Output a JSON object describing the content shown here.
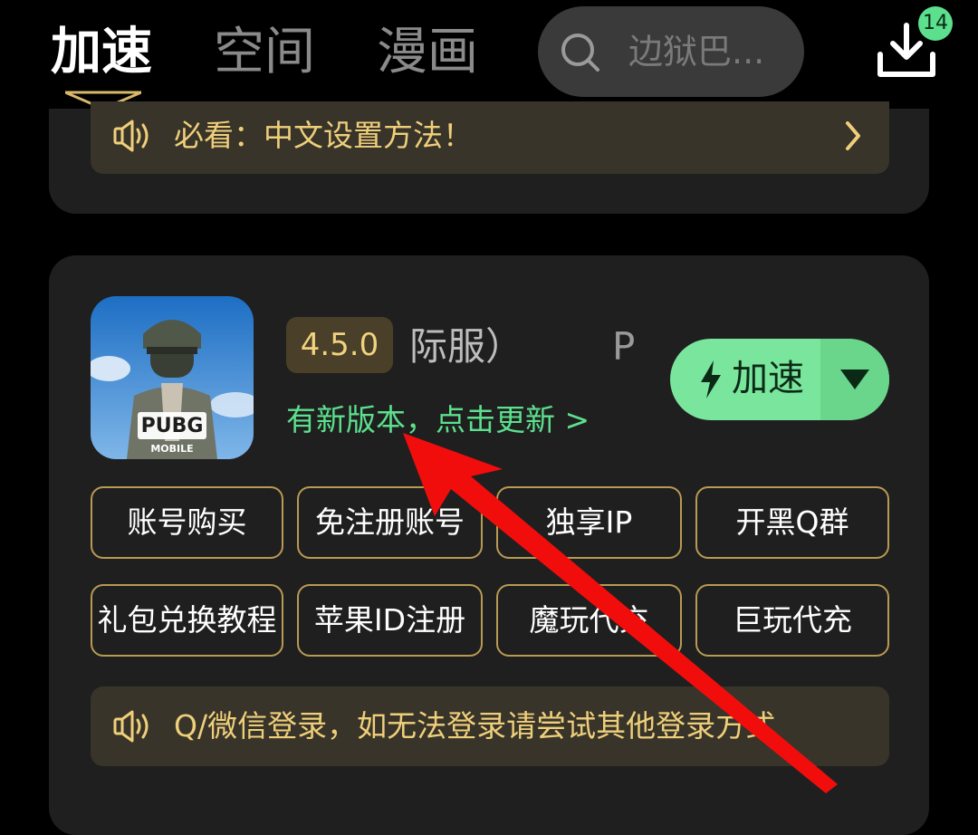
{
  "top_nav": {
    "tabs": [
      {
        "label": "加速",
        "active": true
      },
      {
        "label": "空间",
        "active": false
      },
      {
        "label": "漫画",
        "active": false
      }
    ],
    "search": {
      "placeholder": "边狱巴..."
    },
    "download": {
      "badge_count": "14"
    }
  },
  "top_card": {
    "notice": {
      "text": "必看：中文设置方法！"
    }
  },
  "game_card": {
    "icon": {
      "name": "pubg-mobile-icon",
      "logo_text": "PUBG",
      "logo_sub": "MOBILE"
    },
    "version": "4.5.0",
    "title_visible": "际服）",
    "title_tail_visible": "P",
    "update_link": "有新版本，点击更新 >",
    "accelerate_button": {
      "label": "加速"
    },
    "chips": [
      "账号购买",
      "免注册账号",
      "独享IP",
      "开黑Q群",
      "礼包兑换教程",
      "苹果ID注册",
      "魔玩代充",
      "巨玩代充"
    ],
    "notice": {
      "text": "Q/微信登录，如无法登录请尝试其他登录方式"
    }
  },
  "colors": {
    "accent_green": "#7ae69d",
    "gold": "#efcf7a",
    "annotation_arrow": "#f20d0d"
  }
}
